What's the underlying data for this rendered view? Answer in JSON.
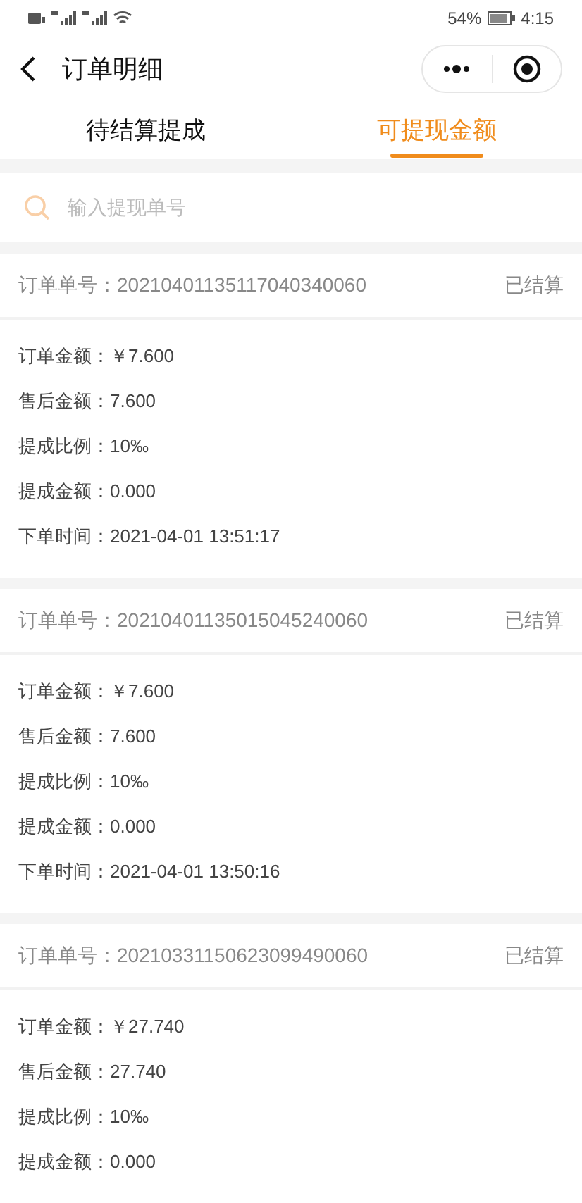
{
  "status_bar": {
    "battery": "54%",
    "time": "4:15"
  },
  "nav": {
    "title": "订单明细"
  },
  "tabs": [
    {
      "label": "待结算提成",
      "selected": false
    },
    {
      "label": "可提现金额",
      "selected": true
    }
  ],
  "search": {
    "placeholder": "输入提现单号"
  },
  "orders": [
    {
      "order_no": "订单单号：20210401135117040340060",
      "status": "已结算",
      "rows": [
        "订单金额：￥7.600",
        "售后金额：7.600",
        "提成比例：10‰",
        "提成金额：0.000",
        "下单时间：2021-04-01 13:51:17"
      ]
    },
    {
      "order_no": "订单单号：20210401135015045240060",
      "status": "已结算",
      "rows": [
        "订单金额：￥7.600",
        "售后金额：7.600",
        "提成比例：10‰",
        "提成金额：0.000",
        "下单时间：2021-04-01 13:50:16"
      ]
    },
    {
      "order_no": "订单单号：20210331150623099490060",
      "status": "已结算",
      "rows": [
        "订单金额：￥27.740",
        "售后金额：27.740",
        "提成比例：10‰",
        "提成金额：0.000"
      ]
    }
  ]
}
